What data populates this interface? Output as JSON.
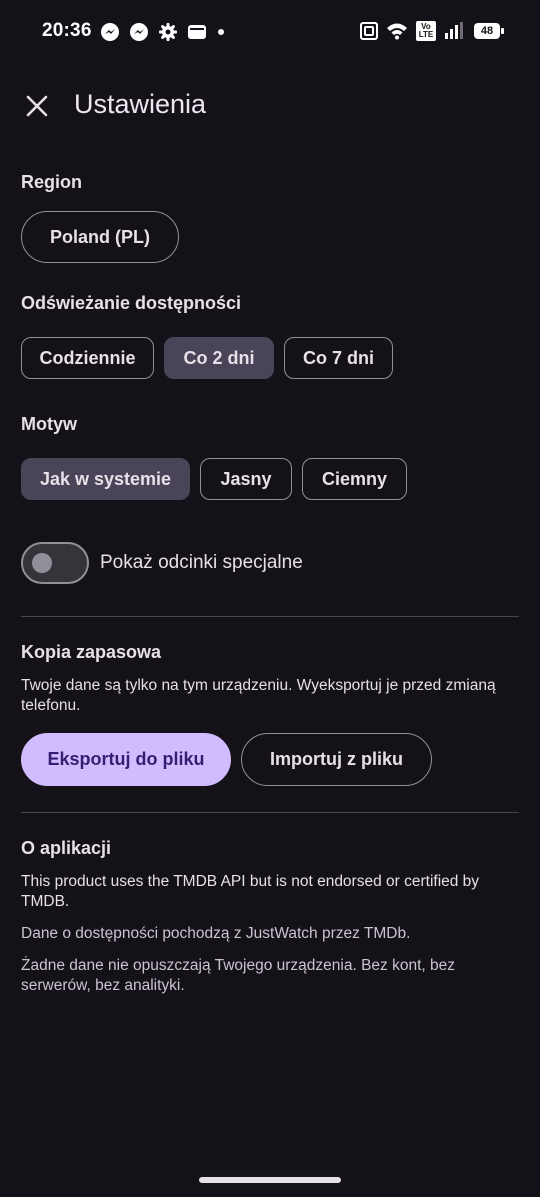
{
  "status_bar": {
    "time": "20:36",
    "network_badge_top": "Vo",
    "network_badge_bottom": "LTE",
    "battery_level": "48",
    "icons": [
      "messenger-icon",
      "messenger-icon",
      "settings-gear-icon",
      "wallet-icon",
      "dot-icon",
      "nfc-icon",
      "wifi-icon",
      "volte-icon",
      "signal-icon",
      "battery-icon"
    ]
  },
  "header": {
    "title": "Ustawienia",
    "close_icon": "close-icon"
  },
  "region": {
    "label": "Region",
    "value": "Poland (PL)"
  },
  "refresh": {
    "label": "Odświeżanie dostępności",
    "options": [
      "Codziennie",
      "Co 2 dni",
      "Co 7 dni"
    ],
    "selected": "Co 2 dni"
  },
  "theme": {
    "label": "Motyw",
    "options": [
      "Jak w systemie",
      "Jasny",
      "Ciemny"
    ],
    "selected": "Jak w systemie"
  },
  "special_episodes": {
    "label": "Pokaż odcinki specjalne",
    "enabled": false
  },
  "backup": {
    "label": "Kopia zapasowa",
    "description": "Twoje dane są tylko na tym urządzeniu. Wyeksportuj je przed zmianą telefonu.",
    "export_label": "Eksportuj do pliku",
    "import_label": "Importuj z pliku"
  },
  "about": {
    "label": "O aplikacji",
    "tmdb_notice": "This product uses the TMDB API but is not endorsed or certified by TMDB.",
    "justwatch_notice": "Dane o dostępności pochodzą z JustWatch przez TMDb.",
    "privacy_notice": "Żadne dane nie opuszczają Twojego urządzenia. Bez kont, bez serwerów, bez analityki."
  },
  "colors": {
    "background": "#141218",
    "accent": "#d0bcff",
    "selected_chip": "#4a4458",
    "outline": "#938f99"
  }
}
